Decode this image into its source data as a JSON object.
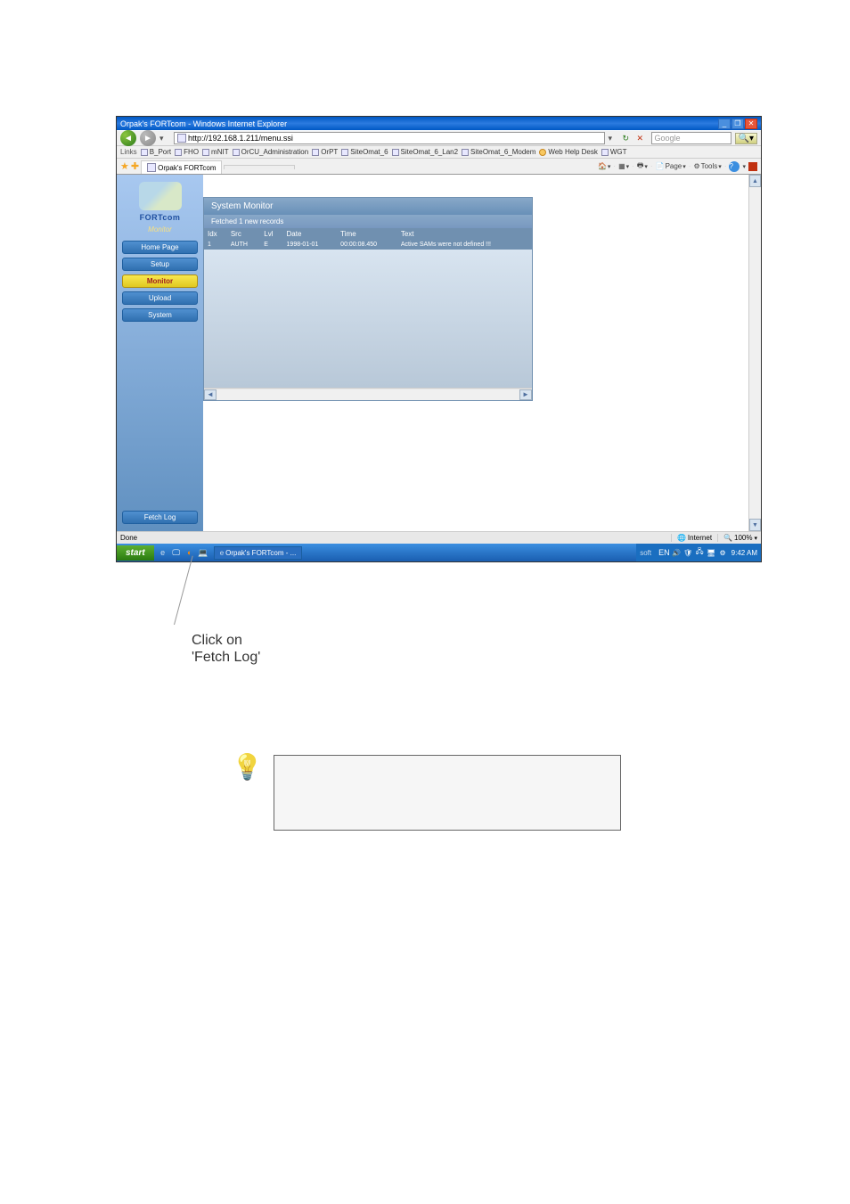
{
  "window": {
    "title": "Orpak's FORTcom - Windows Internet Explorer",
    "url": "http://192.168.1.211/menu.ssi",
    "search_placeholder": "Google",
    "tab_title": "Orpak's FORTcom",
    "status_left": "Done",
    "status_zone": "Internet",
    "status_zoom": "100%"
  },
  "links": {
    "label": "Links",
    "items": [
      "B_Port",
      "FHO",
      "mNIT",
      "OrCU_Administration",
      "OrPT",
      "SiteOmat_6",
      "SiteOmat_6_Lan2",
      "SiteOmat_6_Modem",
      "Web Help Desk",
      "WGT"
    ]
  },
  "toolbar": {
    "page": "Page",
    "tools": "Tools"
  },
  "sidebar": {
    "brand": "FORTcom",
    "section": "Monitor",
    "items": [
      {
        "label": "Home Page"
      },
      {
        "label": "Setup"
      },
      {
        "label": "Monitor"
      },
      {
        "label": "Upload"
      },
      {
        "label": "System"
      }
    ],
    "fetch": "Fetch Log"
  },
  "monitor": {
    "title": "System Monitor",
    "subtitle": "Fetched 1 new records",
    "columns": [
      "Idx",
      "Src",
      "Lvl",
      "Date",
      "Time",
      "Text"
    ],
    "rows": [
      {
        "idx": "1",
        "src": "AUTH",
        "lvl": "E",
        "date": "1998-01-01",
        "time": "00:00:08.450",
        "text": "Active SAMs were not defined !!!"
      }
    ]
  },
  "taskbar": {
    "start": "start",
    "task": "Orpak's FORTcom - ...",
    "soft": "soft",
    "lang": "EN",
    "time": "9:42 AM"
  },
  "callout": {
    "line1": "Click on",
    "line2": "'Fetch Log'"
  }
}
